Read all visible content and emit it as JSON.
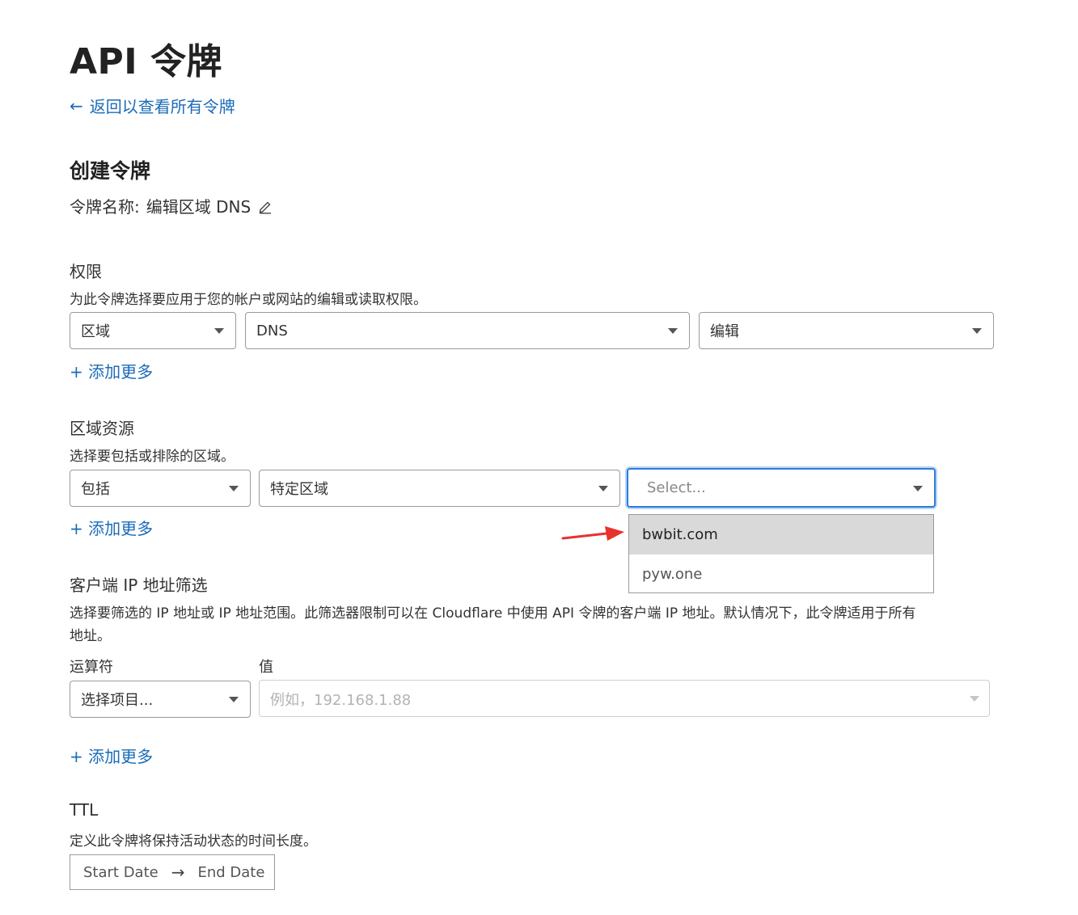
{
  "header": {
    "title": "API 令牌",
    "back_link": "返回以查看所有令牌"
  },
  "create": {
    "title": "创建令牌",
    "name_label": "令牌名称:",
    "name_value": "编辑区域 DNS"
  },
  "permissions": {
    "title": "权限",
    "description": "为此令牌选择要应用于您的帐户或网站的编辑或读取权限。",
    "selects": [
      "区域",
      "DNS",
      "编辑"
    ],
    "add_more": "+ 添加更多"
  },
  "zone_resources": {
    "title": "区域资源",
    "description": "选择要包括或排除的区域。",
    "selects": [
      "包括",
      "特定区域"
    ],
    "select_placeholder": "Select...",
    "options": [
      "bwbit.com",
      "pyw.one"
    ],
    "add_more": "+ 添加更多"
  },
  "ip_filter": {
    "title": "客户端 IP 地址筛选",
    "description_line1": "选择要筛选的 IP 地址或 IP 地址范围。此筛选器限制可以在 Cloudflare 中使用 API 令牌的客户端 IP 地址。默认情况下，此令牌适用于所有",
    "description_line2": "地址。",
    "operator_label": "运算符",
    "value_label": "值",
    "operator_placeholder": "选择项目...",
    "value_placeholder": "例如，192.168.1.88",
    "add_more": "+ 添加更多"
  },
  "ttl": {
    "title": "TTL",
    "description": "定义此令牌将保持活动状态的时间长度。",
    "start": "Start Date",
    "end": "End Date"
  },
  "icons": {
    "back": "arrow-left-icon",
    "edit": "pencil-icon",
    "date_sep": "arrow-right-icon",
    "annotation": "red-arrow-icon"
  },
  "colors": {
    "link": "#1a6bb8",
    "focus": "#2f7bdc",
    "highlight": "#d9d9d9",
    "annotation": "#e8322e"
  }
}
